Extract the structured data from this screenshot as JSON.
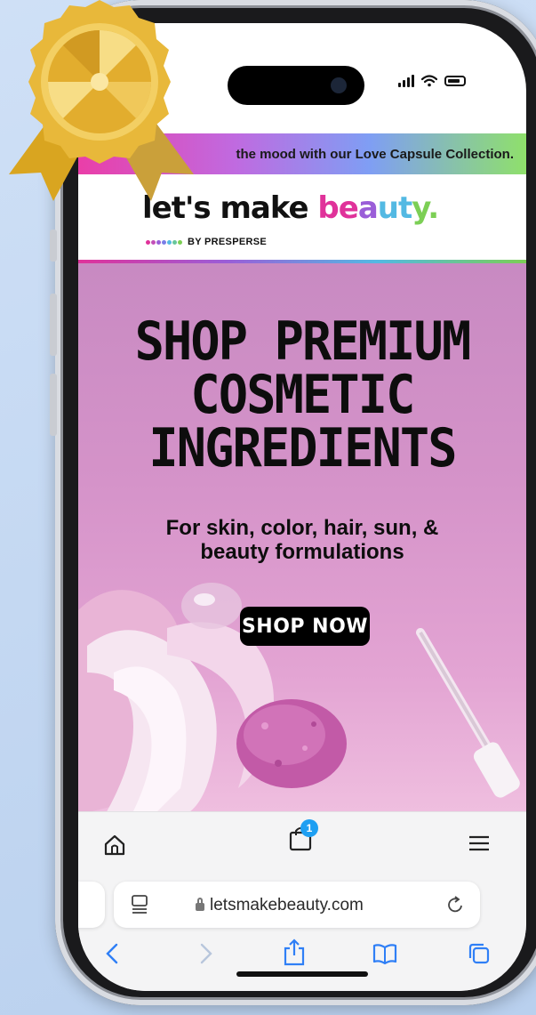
{
  "promo_banner": {
    "text": "the mood with our Love Capsule Collection."
  },
  "brand": {
    "logo_part1": "let's make ",
    "logo_part2_letters": [
      "be",
      "a",
      "ut",
      "y."
    ],
    "byline": "BY PRESPERSE",
    "colors": {
      "pink": "#e0329a",
      "purple": "#9a5ed8",
      "blue": "#53b9e3",
      "green": "#7ccf55"
    }
  },
  "hero": {
    "title_lines": [
      "SHOP PREMIUM",
      "COSMETIC",
      "INGREDIENTS"
    ],
    "subtitle_lines": [
      "For skin, color, hair, sun, &",
      "beauty formulations"
    ],
    "cta_label": "SHOP NOW",
    "background_color": "#d593c9"
  },
  "toolbar": {
    "cart_count": "1",
    "icons": [
      "home-icon",
      "shopping-bag-icon",
      "hamburger-menu-icon"
    ]
  },
  "browser": {
    "url": "letsmakebeauty.com",
    "nav_icons": [
      "back-chevron-icon",
      "forward-chevron-icon",
      "share-icon",
      "bookmarks-icon",
      "tabs-icon"
    ]
  }
}
